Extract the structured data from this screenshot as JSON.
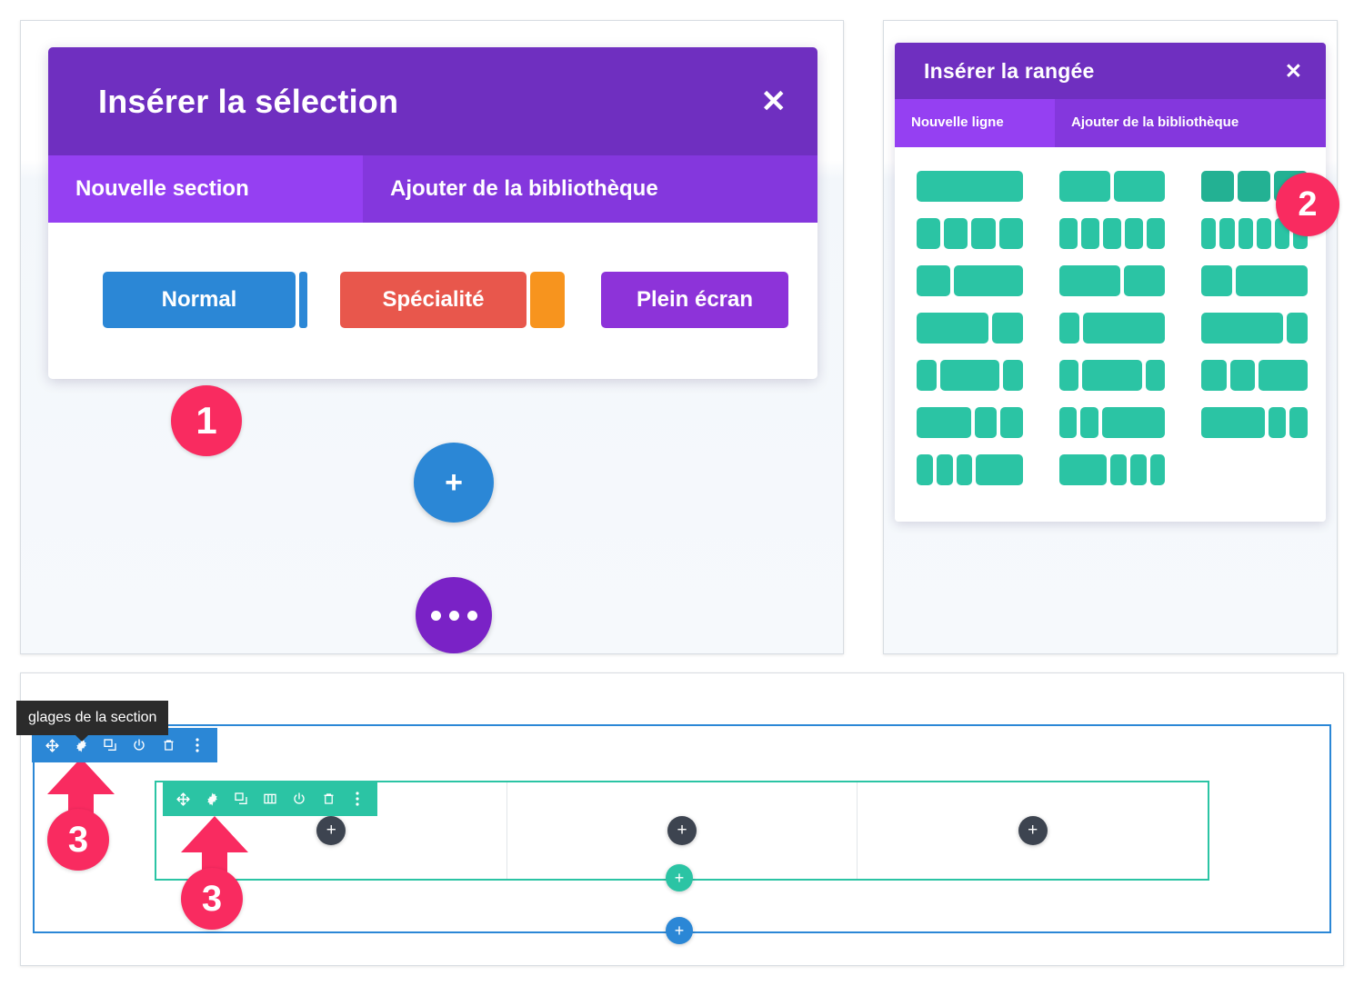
{
  "section_modal": {
    "title": "Insérer la sélection",
    "close_label": "✕",
    "tabs": [
      {
        "label": "Nouvelle section",
        "selected": true
      },
      {
        "label": "Ajouter de la bibliothèque",
        "selected": false
      }
    ],
    "buttons": [
      {
        "label": "Normal",
        "color": "#2b87d6"
      },
      {
        "label": "Spécialité",
        "color": "#e8574c"
      },
      {
        "label": "Plein écran",
        "color": "#8d33d9"
      }
    ],
    "fab_add_label": "+",
    "fab_more_icon": "ellipsis-icon"
  },
  "row_modal": {
    "title": "Insérer la rangée",
    "close_label": "✕",
    "tabs": [
      {
        "label": "Nouvelle ligne",
        "selected": true
      },
      {
        "label": "Ajouter de la bibliothèque",
        "selected": false
      }
    ],
    "layouts": [
      [
        [
          100
        ],
        [
          50,
          50
        ],
        [
          33,
          33,
          34
        ]
      ],
      [
        [
          25,
          25,
          25,
          25
        ],
        [
          20,
          20,
          20,
          20,
          20
        ],
        [
          16,
          16,
          16,
          16,
          16,
          16
        ]
      ],
      [
        [
          33,
          67
        ],
        [
          60,
          40
        ],
        [
          30,
          70
        ]
      ],
      [
        [
          70,
          30
        ],
        [
          20,
          80
        ],
        [
          80,
          20
        ]
      ],
      [
        [
          20,
          60,
          20
        ],
        [
          20,
          60,
          20
        ],
        [
          25,
          25,
          50
        ]
      ],
      [
        [
          55,
          22,
          23
        ],
        [
          18,
          18,
          64
        ],
        [
          64,
          18,
          18
        ]
      ],
      [
        [
          17,
          17,
          17,
          49
        ],
        [
          50,
          17,
          17,
          16
        ],
        []
      ]
    ],
    "accent": "#2bc4a4",
    "accent_hover": "#23b193",
    "fab_more_icon": "ellipsis-icon",
    "fab_add_green_label": "+"
  },
  "builder": {
    "tooltip_text": "glages de la section",
    "section_toolbar": {
      "color": "#2b87d6",
      "icons": [
        "move-icon",
        "gear-icon",
        "duplicate-icon",
        "power-icon",
        "trash-icon",
        "ellipsis-vertical-icon"
      ]
    },
    "row_toolbar": {
      "color": "#2bc4a4",
      "icons": [
        "move-icon",
        "gear-icon",
        "duplicate-icon",
        "columns-icon",
        "power-icon",
        "trash-icon",
        "ellipsis-vertical-icon"
      ]
    },
    "columns": [
      {
        "add_label": "+"
      },
      {
        "add_label": "+"
      },
      {
        "add_label": "+"
      }
    ],
    "add_row_label": "+",
    "add_section_label": "+"
  },
  "markers": [
    {
      "id": "1",
      "label": "1"
    },
    {
      "id": "2",
      "label": "2"
    },
    {
      "id": "3a",
      "label": "3"
    },
    {
      "id": "3b",
      "label": "3"
    }
  ],
  "colors": {
    "purple_dark": "#6f2fc0",
    "purple_mid": "#8437dd",
    "purple_light": "#9540f2",
    "blue": "#2b87d6",
    "teal": "#2bc4a4",
    "pink": "#f92b60",
    "orange": "#f7941e",
    "red": "#e8574c"
  }
}
